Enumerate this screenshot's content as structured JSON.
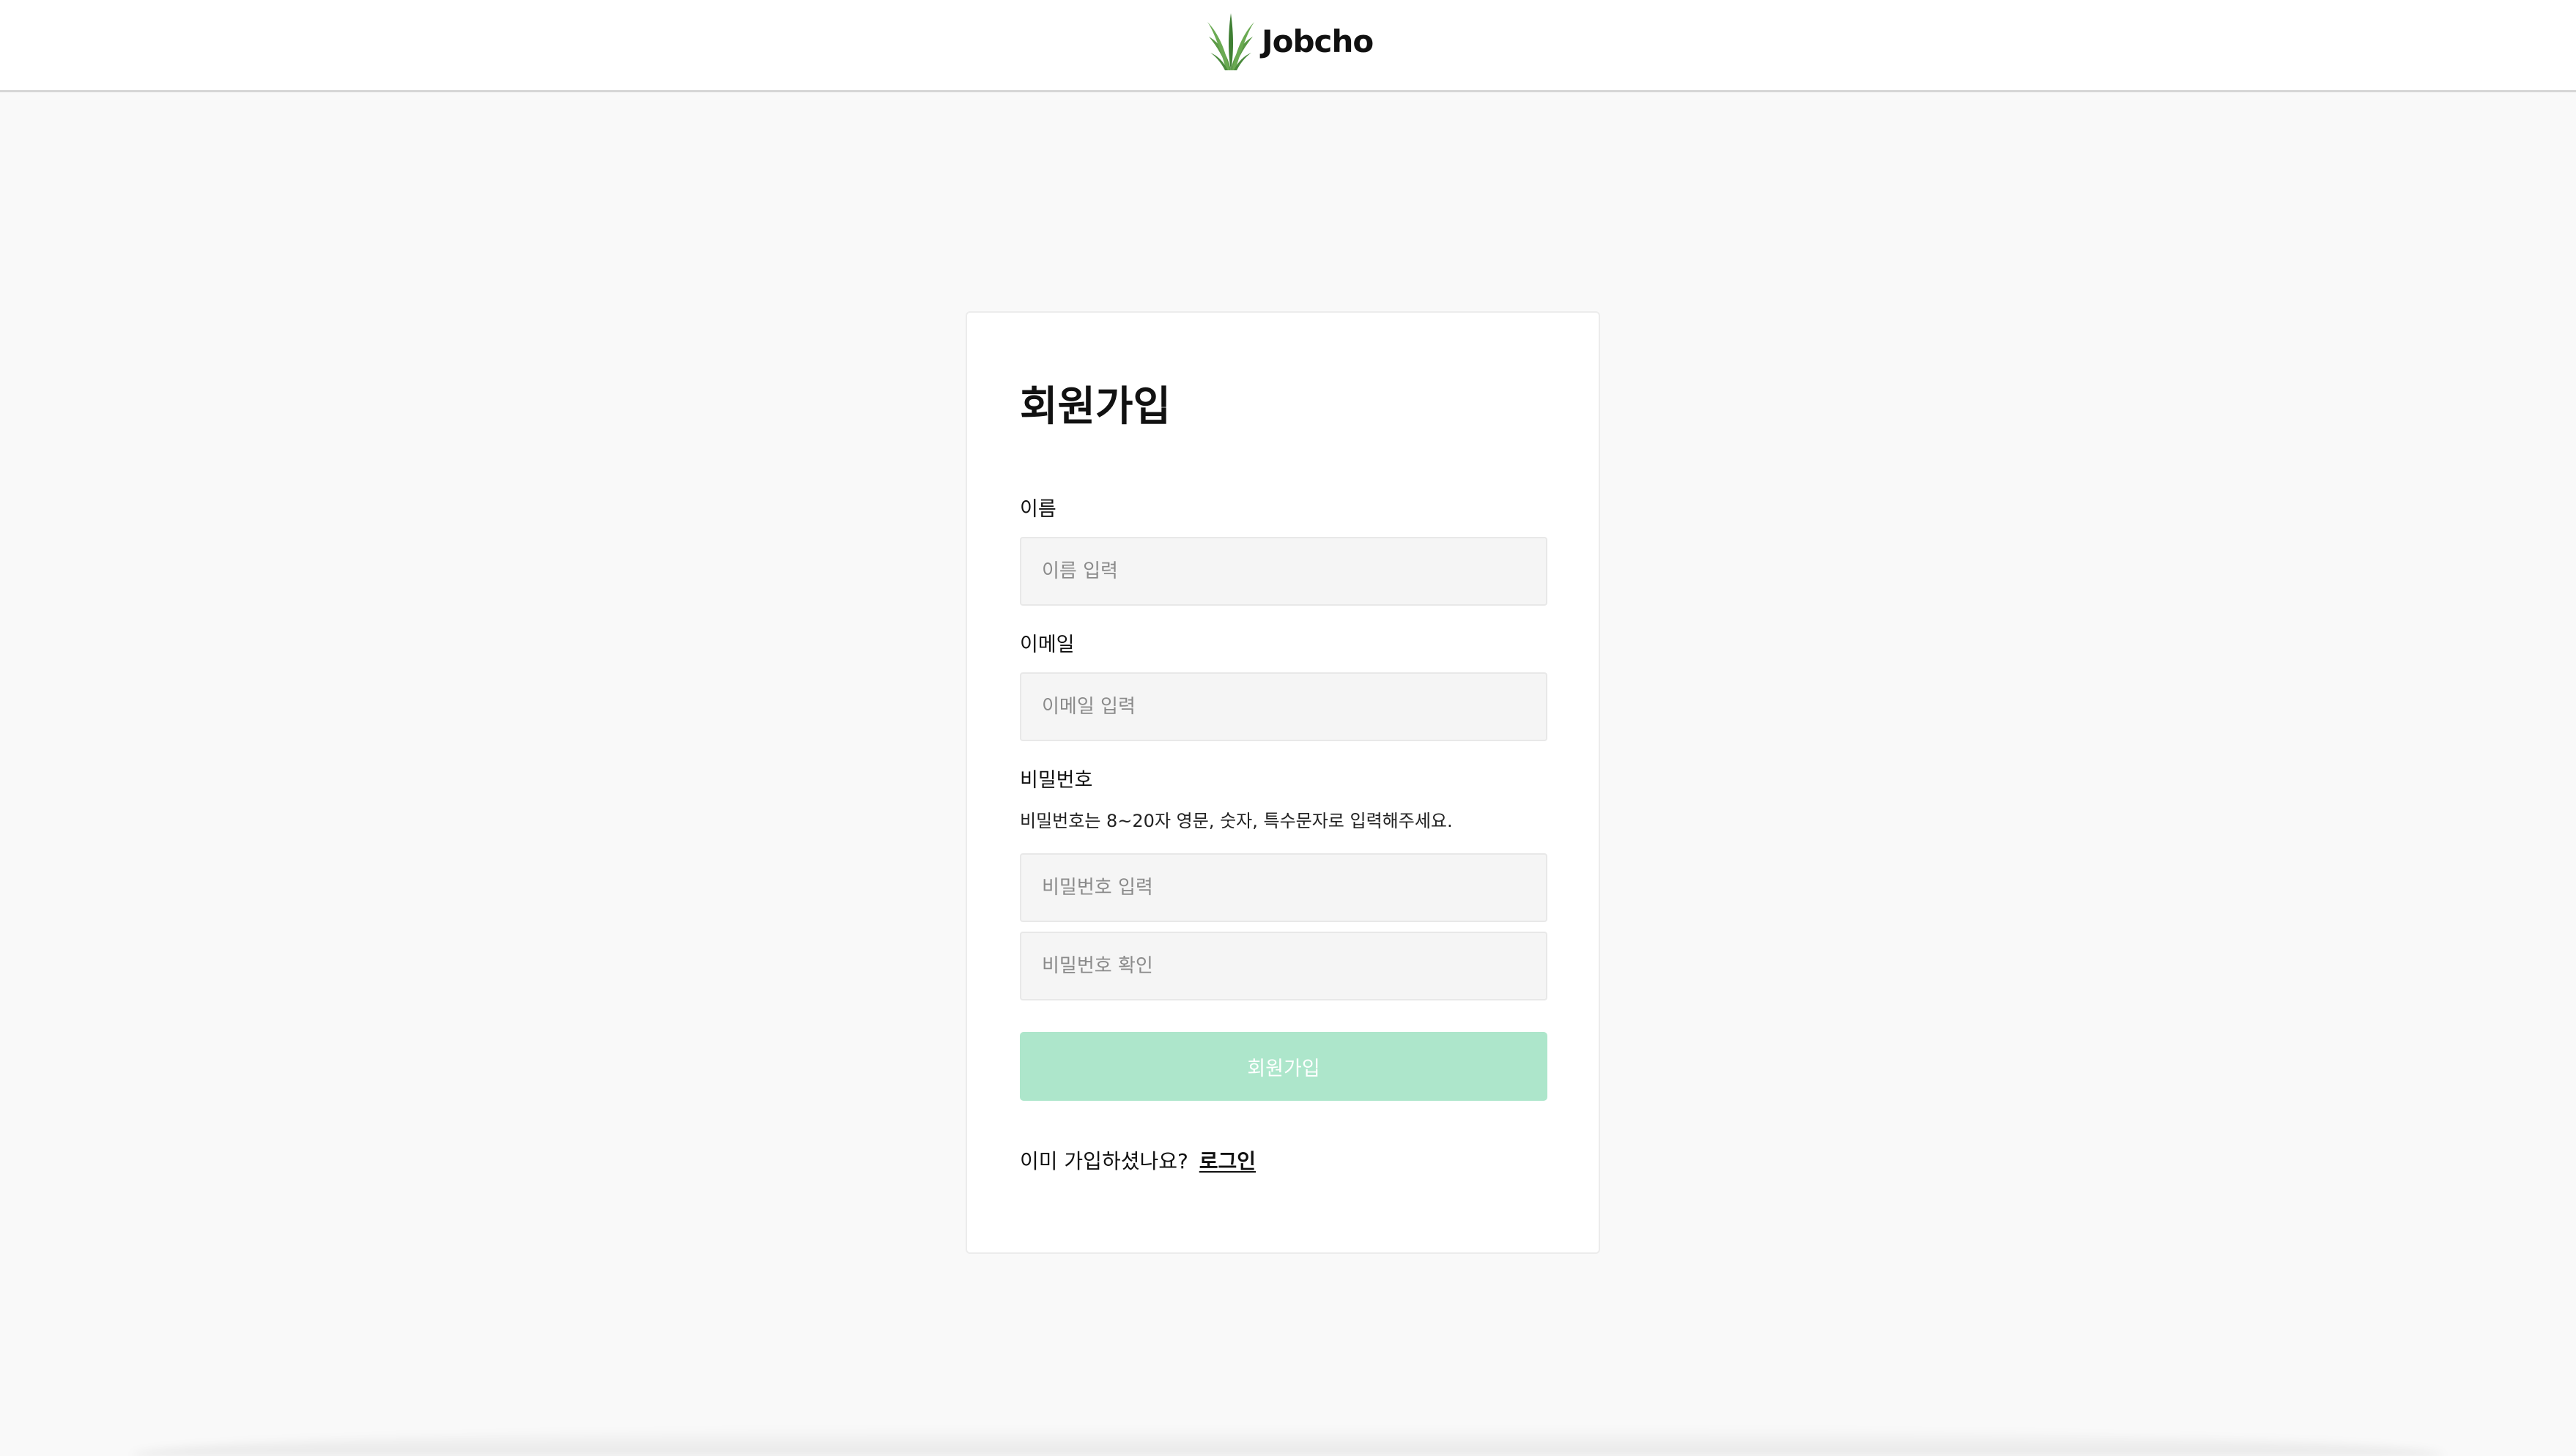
{
  "header": {
    "logo_text": "Jobcho",
    "logo_icon": "grass-icon"
  },
  "form": {
    "title": "회원가입",
    "name_label": "이름",
    "name_placeholder": "이름 입력",
    "name_value": "",
    "email_label": "이메일",
    "email_placeholder": "이메일 입력",
    "email_value": "",
    "password_label": "비밀번호",
    "password_helper": "비밀번호는 8~20자 영문, 숫자, 특수문자로 입력해주세요.",
    "password_placeholder": "비밀번호 입력",
    "password_value": "",
    "password_confirm_placeholder": "비밀번호 확인",
    "password_confirm_value": "",
    "submit_label": "회원가입",
    "already_text": "이미 가입하셨나요?",
    "login_link": "로그인"
  },
  "colors": {
    "background": "#f9f9f9",
    "card": "#ffffff",
    "submit_disabled": "#ade6cb",
    "logo_green": "#4a8a3c"
  }
}
